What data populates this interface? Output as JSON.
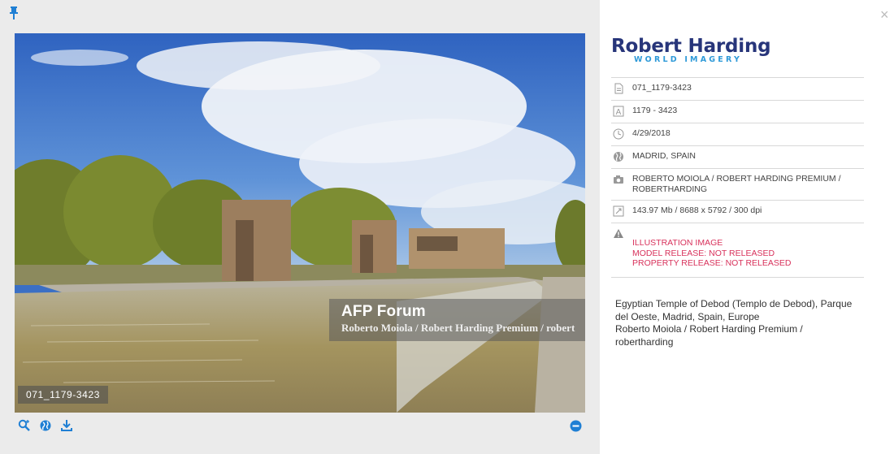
{
  "media": {
    "pin_icon": "pin-icon",
    "watermark": {
      "title": "AFP Forum",
      "credit": "Roberto Moiola / Robert Harding Premium / robert"
    },
    "photo_id": "071_1179-3423",
    "tools": [
      "zoom-icon",
      "globe-icon",
      "download-icon"
    ],
    "minus_icon": "minus-circle-icon",
    "accent_color": "#1f7fd4"
  },
  "panel": {
    "close_label": "×",
    "brand": {
      "name": "Robert Harding",
      "subtitle": "WORLD IMAGERY"
    },
    "meta": {
      "file_id": "071_1179-3423",
      "reference": "1179 - 3423",
      "date": "4/29/2018",
      "location": "MADRID, SPAIN",
      "credit": "ROBERTO MOIOLA / ROBERT HARDING PREMIUM / ROBERTHARDING",
      "size": "143.97 Mb / 8688 x 5792 / 300 dpi",
      "warnings": [
        "ILLUSTRATION IMAGE",
        "MODEL RELEASE: NOT RELEASED",
        "PROPERTY RELEASE: NOT RELEASED"
      ]
    },
    "description": [
      "Egyptian Temple of Debod (Templo de Debod), Parque del Oeste, Madrid, Spain, Europe",
      "Roberto Moiola / Robert Harding Premium / robertharding"
    ],
    "warning_color": "#d8315b"
  }
}
